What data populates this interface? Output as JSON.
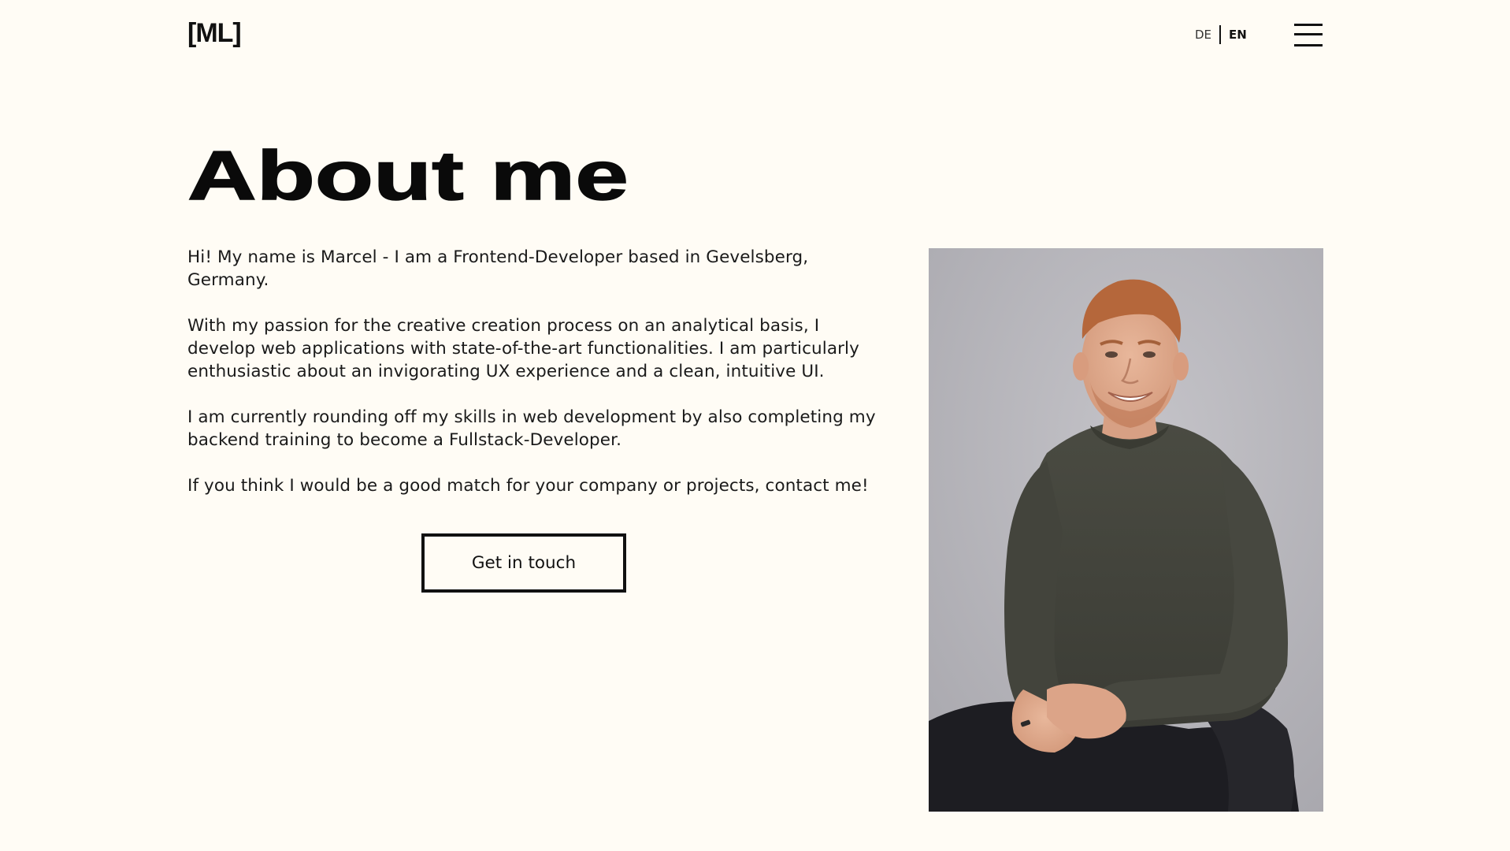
{
  "header": {
    "logo_text": "[ML]",
    "languages": {
      "de": "DE",
      "en": "EN",
      "active": "EN"
    },
    "menu_icon": "hamburger-menu-icon"
  },
  "main": {
    "title": "About me",
    "paragraphs": [
      "Hi! My name is Marcel - I am a Frontend-Developer based in Gevelsberg, Germany.",
      "With my passion for the creative creation process on an analytical basis, I develop web applications with state-of-the-art functionalities. I am particularly enthusiastic about an invigorating UX experience and a clean, intuitive UI.",
      "I am currently rounding off my skills in web development by also completing my backend training to become a Fullstack-Developer.",
      "If you think I would be a good match for your company or projects, contact me!"
    ],
    "cta_label": "Get in touch",
    "portrait": "portrait-photo"
  },
  "colors": {
    "background": "#fffcf5",
    "text": "#111111",
    "photo_background": "#b9b8bd",
    "sweater": "#45463e",
    "hair": "#b5673b"
  }
}
